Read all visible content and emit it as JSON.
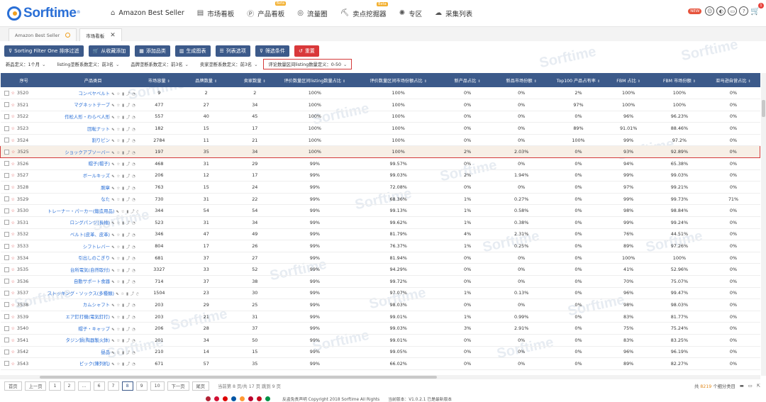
{
  "brand": {
    "name": "Sorftime",
    "reg": "®"
  },
  "nav": [
    {
      "icon": "⌂",
      "label": "Amazon Best Seller",
      "beta": ""
    },
    {
      "icon": "▤",
      "label": "市场看板",
      "beta": ""
    },
    {
      "icon": "Ⓟ",
      "label": "产品看板",
      "beta": "Beta"
    },
    {
      "icon": "◎",
      "label": "流量圈",
      "beta": ""
    },
    {
      "icon": "⛏",
      "label": "卖点挖掘器",
      "beta": "Beta"
    },
    {
      "icon": "✺",
      "label": "专区",
      "beta": ""
    },
    {
      "icon": "☁",
      "label": "采集列表",
      "beta": ""
    }
  ],
  "nav_right": {
    "new_badge": "NEW",
    "cart_count": "1"
  },
  "tabs": [
    {
      "label": "Amazon Best Seller",
      "active": false
    },
    {
      "label": "市场看板",
      "active": true
    }
  ],
  "toolbar": [
    {
      "icon": "⊽",
      "label": "Sorting Filter One 排序过滤",
      "style": "blue"
    },
    {
      "icon": "🛒",
      "label": "从收藏添加",
      "style": "blue"
    },
    {
      "icon": "▦",
      "label": "添加品类",
      "style": "blue"
    },
    {
      "icon": "▥",
      "label": "生成图表",
      "style": "blue"
    },
    {
      "icon": "☰",
      "label": "列表选项",
      "style": "blue"
    },
    {
      "icon": "⊽",
      "label": "筛选条件",
      "style": "blue"
    },
    {
      "icon": "↺",
      "label": "重置",
      "style": "red"
    }
  ],
  "filters": [
    {
      "label": "新品定义：",
      "value": "1个月"
    },
    {
      "label": "listing垄断系数定义：",
      "value": "前3名"
    },
    {
      "label": "品牌垄断系数定义：",
      "value": "前3名"
    },
    {
      "label": "卖家垄断系数定义：",
      "value": "前3名"
    },
    {
      "label": "评论数量区间listing数量定义：",
      "value": "0-50"
    }
  ],
  "columns": [
    "序号",
    "产品类目",
    "市场容量",
    "品牌数量",
    "卖家数量",
    "评价数量区间listing数量占比",
    "评价数量区间市场份额占比",
    "新产品占比",
    "新品市场份额",
    "Top100 产品占有率",
    "FBM 占比",
    "FBM 市场份额",
    "亚马逊自营占比"
  ],
  "rows": [
    [
      "3520",
      "コンペヤベルト",
      "9",
      "2",
      "2",
      "100%",
      "100%",
      "0%",
      "0%",
      "2%",
      "100%",
      "100%",
      "0%"
    ],
    [
      "3521",
      "マグネットテープ",
      "477",
      "27",
      "34",
      "100%",
      "100%",
      "0%",
      "0%",
      "97%",
      "100%",
      "100%",
      "0%"
    ],
    [
      "3522",
      "作松人形・わらべ人形",
      "557",
      "40",
      "45",
      "100%",
      "100%",
      "0%",
      "0%",
      "0%",
      "96%",
      "96.23%",
      "0%"
    ],
    [
      "3523",
      "回転ナット",
      "182",
      "15",
      "17",
      "100%",
      "100%",
      "0%",
      "0%",
      "89%",
      "91.01%",
      "88.46%",
      "0%"
    ],
    [
      "3524",
      "割りピン",
      "2784",
      "11",
      "21",
      "100%",
      "100%",
      "0%",
      "0%",
      "100%",
      "99%",
      "97.2%",
      "0%"
    ],
    [
      "3525",
      "ショックアブソーバー",
      "197",
      "35",
      "34",
      "100%",
      "100%",
      "2%",
      "2.03%",
      "0%",
      "93%",
      "92.89%",
      "0%"
    ],
    [
      "3526",
      "帽子(帽子)",
      "468",
      "31",
      "29",
      "99%",
      "99.57%",
      "0%",
      "0%",
      "0%",
      "94%",
      "65.38%",
      "0%"
    ],
    [
      "3527",
      "ボールキッズ",
      "206",
      "12",
      "17",
      "99%",
      "99.03%",
      "2%",
      "1.94%",
      "0%",
      "99%",
      "99.03%",
      "0%"
    ],
    [
      "3528",
      "腕章",
      "763",
      "15",
      "24",
      "99%",
      "72.08%",
      "0%",
      "0%",
      "0%",
      "97%",
      "99.21%",
      "0%"
    ],
    [
      "3529",
      "なた",
      "730",
      "31",
      "22",
      "99%",
      "68.36%",
      "1%",
      "0.27%",
      "0%",
      "99%",
      "99.73%",
      "71%"
    ],
    [
      "3530",
      "トレーナー・パーカー(鍛造用品)",
      "344",
      "54",
      "54",
      "99%",
      "99.13%",
      "1%",
      "0.58%",
      "0%",
      "98%",
      "98.84%",
      "0%"
    ],
    [
      "3531",
      "ロングパンツ(長袖)",
      "523",
      "31",
      "34",
      "99%",
      "99.62%",
      "1%",
      "0.38%",
      "0%",
      "99%",
      "99.24%",
      "0%"
    ],
    [
      "3532",
      "ベルト(皮革、皮革)",
      "346",
      "47",
      "49",
      "99%",
      "81.79%",
      "4%",
      "2.31%",
      "0%",
      "76%",
      "44.51%",
      "0%"
    ],
    [
      "3533",
      "シフトレバー",
      "804",
      "17",
      "26",
      "99%",
      "76.37%",
      "1%",
      "0.25%",
      "0%",
      "89%",
      "97.26%",
      "0%"
    ],
    [
      "3534",
      "引出しのこぎり",
      "681",
      "37",
      "27",
      "99%",
      "81.94%",
      "0%",
      "0%",
      "0%",
      "100%",
      "100%",
      "0%"
    ],
    [
      "3535",
      "台所電気(自然取付)",
      "3327",
      "33",
      "52",
      "99%",
      "94.29%",
      "0%",
      "0%",
      "0%",
      "41%",
      "52.96%",
      "0%"
    ],
    [
      "3536",
      "自動サポート食器",
      "714",
      "37",
      "38",
      "99%",
      "99.72%",
      "0%",
      "0%",
      "0%",
      "70%",
      "75.07%",
      "0%"
    ],
    [
      "3537",
      "ストッキング・ソックス(多種類)",
      "1504",
      "23",
      "30",
      "99%",
      "97.07%",
      "1%",
      "0.13%",
      "0%",
      "96%",
      "99.47%",
      "0%"
    ],
    [
      "3538",
      "カムシャフト",
      "203",
      "29",
      "25",
      "99%",
      "98.03%",
      "0%",
      "0%",
      "0%",
      "98%",
      "98.03%",
      "0%"
    ],
    [
      "3539",
      "エア釘打機(電気釘打)",
      "203",
      "21",
      "31",
      "99%",
      "99.01%",
      "1%",
      "0.99%",
      "0%",
      "83%",
      "81.77%",
      "0%"
    ],
    [
      "3540",
      "帽子・キャップ",
      "206",
      "28",
      "37",
      "99%",
      "99.03%",
      "3%",
      "2.91%",
      "0%",
      "75%",
      "75.24%",
      "0%"
    ],
    [
      "3541",
      "タジン鍋(陶器製火鉢)",
      "201",
      "34",
      "50",
      "99%",
      "99.01%",
      "0%",
      "0%",
      "0%",
      "83%",
      "83.25%",
      "0%"
    ],
    [
      "3542",
      "昼品",
      "210",
      "14",
      "15",
      "99%",
      "99.05%",
      "0%",
      "0%",
      "0%",
      "96%",
      "96.19%",
      "0%"
    ],
    [
      "3543",
      "ピック(陳列机)",
      "671",
      "57",
      "35",
      "99%",
      "66.02%",
      "0%",
      "0%",
      "0%",
      "89%",
      "82.27%",
      "0%"
    ]
  ],
  "highlight_row": "3525",
  "pager": {
    "first": "首页",
    "prev": "上一页",
    "next": "下一页",
    "last": "尾页",
    "pages": [
      "1",
      "2",
      "...",
      "6",
      "7",
      "8",
      "9",
      "10"
    ],
    "active": "8",
    "info": "当前第 8 页/共 17 页 跳到 9 页",
    "summary_prefix": "共",
    "summary_count": "8219",
    "summary_suffix": "个细分类目"
  },
  "footer": {
    "text": "反盗免责声明 Copyright 2018 Sorftime All Rights",
    "version": "当前版本：V1.0.2.1 已是最新版本"
  },
  "flag_colors": [
    "#b22234",
    "#d21034",
    "#dd0000",
    "#0055a4",
    "#ff9933",
    "#bc002d",
    "#c60b1e",
    "#009246"
  ]
}
